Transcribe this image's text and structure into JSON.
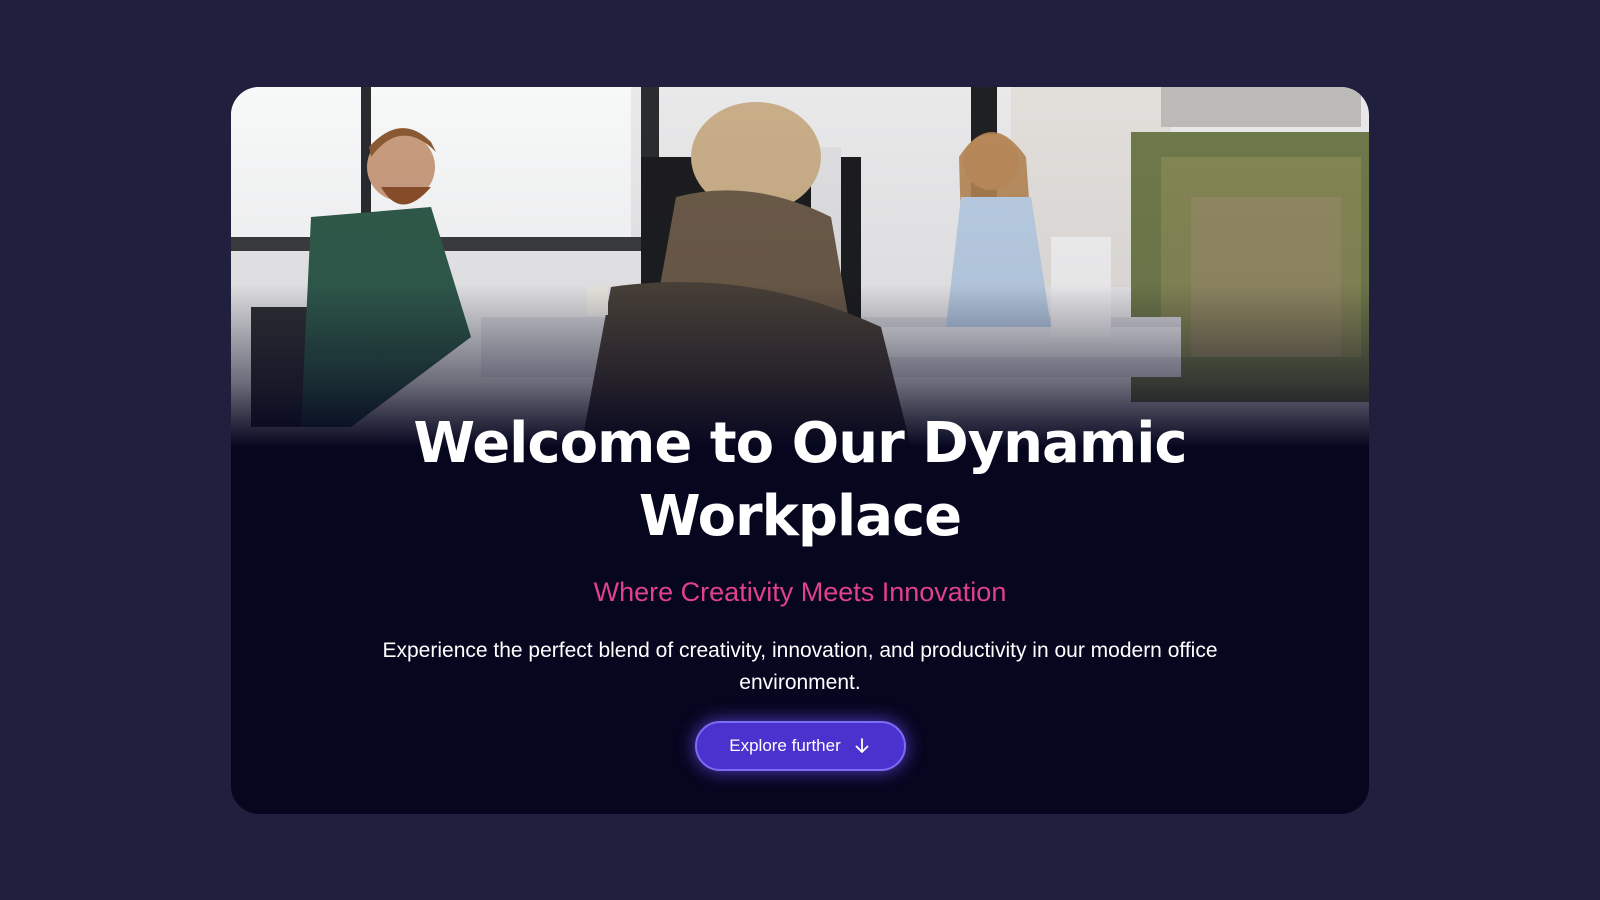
{
  "hero": {
    "title": "Welcome to Our Dynamic Workplace",
    "subtitle": "Where Creativity Meets Innovation",
    "description": "Experience the perfect blend of creativity, innovation, and productivity in our modern office environment.",
    "cta_label": "Explore further",
    "cta_icon": "arrow-down-icon"
  },
  "colors": {
    "page_background": "#211f3e",
    "card_background": "#06061f",
    "title": "#ffffff",
    "subtitle_accent": "#e0408f",
    "button_fill": "#4b32cf",
    "button_border": "#7b6cf5"
  }
}
